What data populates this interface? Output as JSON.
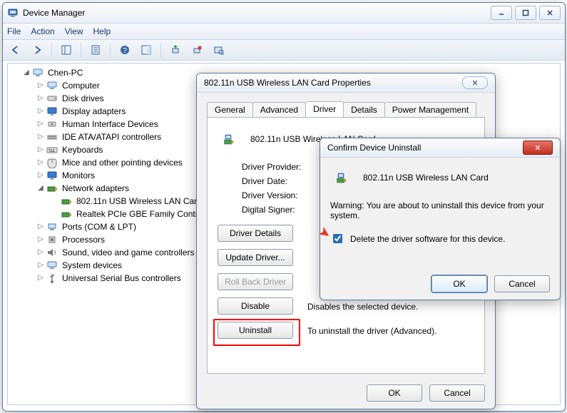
{
  "app": {
    "title": "Device Manager",
    "menu": [
      "File",
      "Action",
      "View",
      "Help"
    ]
  },
  "tree": {
    "root": "Chen-PC",
    "items": [
      {
        "label": "Computer"
      },
      {
        "label": "Disk drives"
      },
      {
        "label": "Display adapters"
      },
      {
        "label": "Human Interface Devices"
      },
      {
        "label": "IDE ATA/ATAPI controllers"
      },
      {
        "label": "Keyboards"
      },
      {
        "label": "Mice and other pointing devices"
      },
      {
        "label": "Monitors"
      },
      {
        "label": "Network adapters",
        "expanded": true,
        "children": [
          {
            "label": "802.11n USB Wireless LAN Card"
          },
          {
            "label": "Realtek PCIe GBE Family Controller"
          }
        ]
      },
      {
        "label": "Ports (COM & LPT)"
      },
      {
        "label": "Processors"
      },
      {
        "label": "Sound, video and game controllers"
      },
      {
        "label": "System devices"
      },
      {
        "label": "Universal Serial Bus controllers"
      }
    ]
  },
  "prop": {
    "title": "802.11n USB Wireless LAN Card Properties",
    "tabs": [
      "General",
      "Advanced",
      "Driver",
      "Details",
      "Power Management"
    ],
    "active_tab": "Driver",
    "device_name": "802.11n USB Wireless LAN Card",
    "rows": [
      {
        "k": "Driver Provider:"
      },
      {
        "k": "Driver Date:"
      },
      {
        "k": "Driver Version:"
      },
      {
        "k": "Digital Signer:"
      }
    ],
    "buttons": {
      "details": "Driver Details",
      "update": "Update Driver...",
      "rollback": "Roll Back Driver",
      "disable": "Disable",
      "uninstall": "Uninstall"
    },
    "desc": {
      "disable": "Disables the selected device.",
      "uninstall": "To uninstall the driver (Advanced)."
    },
    "ok": "OK",
    "cancel": "Cancel"
  },
  "confirm": {
    "title": "Confirm Device Uninstall",
    "device_name": "802.11n USB Wireless LAN Card",
    "warning": "Warning: You are about to uninstall this device from your system.",
    "checkbox": "Delete the driver software for this device.",
    "checked": true,
    "ok": "OK",
    "cancel": "Cancel"
  }
}
